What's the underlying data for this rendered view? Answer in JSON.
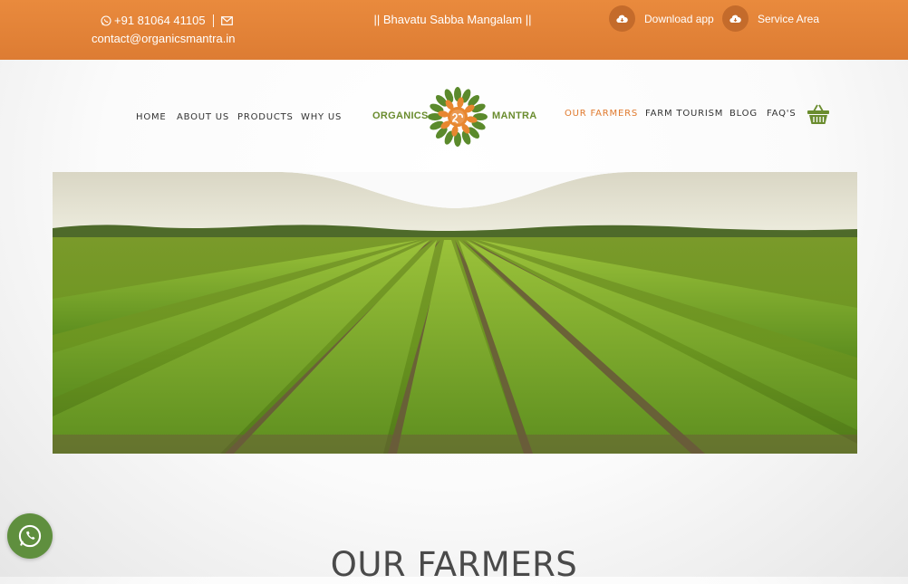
{
  "topbar": {
    "phone": "+91 81064 41105",
    "email": "contact@organicsmantra.in",
    "tagline": "|| Bhavatu Sabba Mangalam ||",
    "download_label": "Download app",
    "service_label": "Service Area",
    "color": "#e4843a"
  },
  "nav": {
    "left": [
      "HOME",
      "ABOUT US",
      "PRODUCTS",
      "WHY US"
    ],
    "right": [
      "OUR FARMERS",
      "FARM TOURISM",
      "BLOG",
      "FAQ'S"
    ],
    "active": "OUR FARMERS",
    "accent": "#e07a2e"
  },
  "logo": {
    "word_left": "ORGANICS",
    "word_right": "MANTRA",
    "color": "#6a8c2e"
  },
  "icons": [
    "whatsapp-icon",
    "mail-icon",
    "cloud-download-icon",
    "basket-icon"
  ],
  "page": {
    "title": "OUR FARMERS"
  }
}
